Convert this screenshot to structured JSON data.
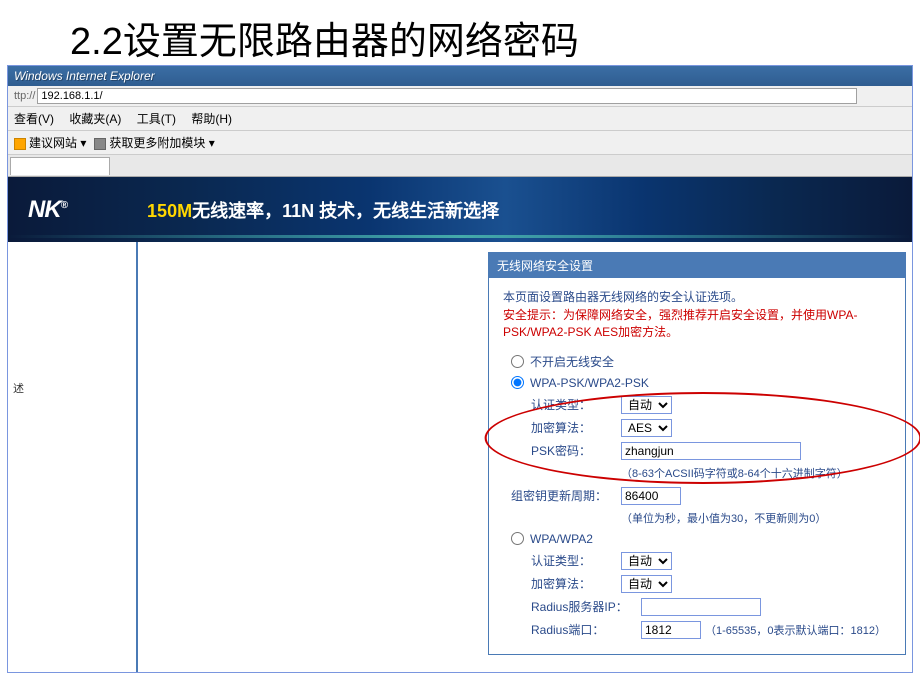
{
  "slide": {
    "title": "2.2设置无限路由器的网络密码"
  },
  "ie": {
    "titlebar": "Windows Internet Explorer",
    "addr_prefix": "ttp://",
    "addr": "192.168.1.1/",
    "menu": {
      "view": "查看(V)",
      "favorites": "收藏夹(A)",
      "tools": "工具(T)",
      "help": "帮助(H)"
    },
    "links": {
      "suggested": "建议网站 ▾",
      "addons": "获取更多附加模块 ▾"
    }
  },
  "banner": {
    "logo": "NK",
    "slogan_hl": "150M",
    "slogan_rest": "无线速率，11N 技术，无线生活新选择"
  },
  "sidebar": {
    "item1": "述"
  },
  "panel": {
    "title": "无线网络安全设置",
    "desc": "本页面设置路由器无线网络的安全认证选项。",
    "warning": "安全提示：为保障网络安全，强烈推荐开启安全设置，并使用WPA-PSK/WPA2-PSK AES加密方法。",
    "opt_none": "不开启无线安全",
    "opt_wpapsk": "WPA-PSK/WPA2-PSK",
    "auth_label": "认证类型：",
    "auth_value": "自动",
    "enc_label": "加密算法：",
    "enc_value": "AES",
    "psk_label": "PSK密码：",
    "psk_value": "zhangjun",
    "psk_hint": "（8-63个ACSII码字符或8-64个十六进制字符）",
    "gk_label": "组密钥更新周期：",
    "gk_value": "86400",
    "gk_hint": "（单位为秒，最小值为30，不更新则为0）",
    "opt_wpa": "WPA/WPA2",
    "auth2_label": "认证类型：",
    "auth2_value": "自动",
    "enc2_label": "加密算法：",
    "enc2_value": "自动",
    "radius_ip_label": "Radius服务器IP：",
    "radius_ip_value": "",
    "radius_port_label": "Radius端口：",
    "radius_port_value": "1812",
    "radius_port_hint": "（1-65535，0表示默认端口：1812）"
  }
}
